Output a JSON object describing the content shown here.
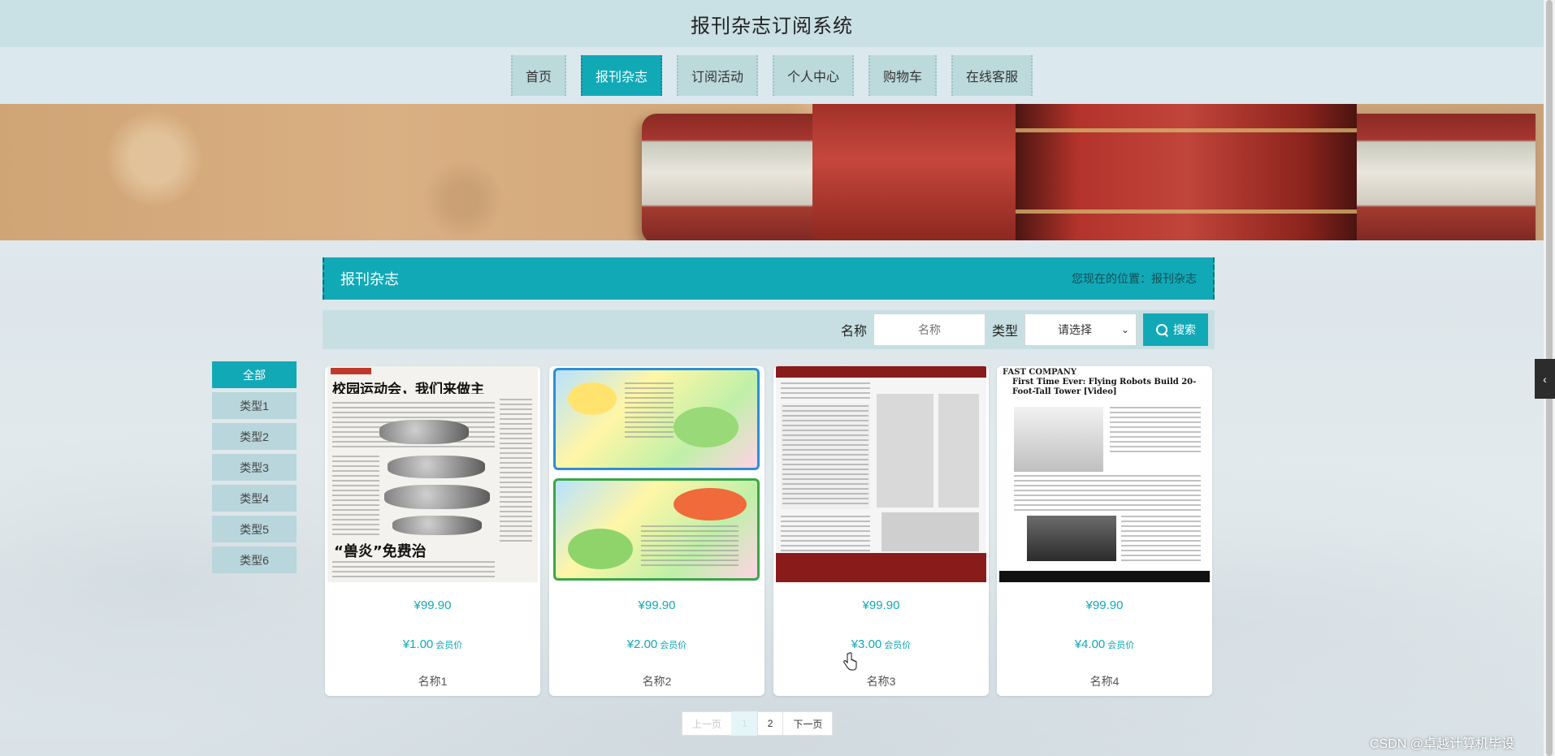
{
  "header": {
    "title": "报刊杂志订阅系统"
  },
  "nav": {
    "items": [
      {
        "label": "首页"
      },
      {
        "label": "报刊杂志"
      },
      {
        "label": "订阅活动"
      },
      {
        "label": "个人中心"
      },
      {
        "label": "购物车"
      },
      {
        "label": "在线客服"
      }
    ],
    "active": "报刊杂志"
  },
  "section": {
    "title": "报刊杂志",
    "location_prefix": "您现在的位置：",
    "location": "报刊杂志"
  },
  "search": {
    "name_label": "名称",
    "name_placeholder": "名称",
    "type_label": "类型",
    "type_selected": "请选择",
    "button_label": "搜索"
  },
  "categories": [
    {
      "label": "全部"
    },
    {
      "label": "类型1"
    },
    {
      "label": "类型2"
    },
    {
      "label": "类型3"
    },
    {
      "label": "类型4"
    },
    {
      "label": "类型5"
    },
    {
      "label": "类型6"
    }
  ],
  "products": [
    {
      "price": "¥99.90",
      "vip_price": "¥1.00",
      "vip_label": "会员价",
      "name": "名称1",
      "image_headline": "校园运动会，我们来做主",
      "image_caption": "“兽炎”免费治"
    },
    {
      "price": "¥99.90",
      "vip_price": "¥2.00",
      "vip_label": "会员价",
      "name": "名称2"
    },
    {
      "price": "¥99.90",
      "vip_price": "¥3.00",
      "vip_label": "会员价",
      "name": "名称3"
    },
    {
      "price": "¥99.90",
      "vip_price": "¥4.00",
      "vip_label": "会员价",
      "name": "名称4",
      "image_logo": "FAST COMPANY",
      "image_title": "First Time Ever: Flying Robots Build 20-Foot-Tall Tower [Video]"
    }
  ],
  "pagination": {
    "prev": "上一页",
    "pages": [
      "1",
      "2"
    ],
    "current": "1",
    "next": "下一页"
  },
  "side_tab_icon": "chevron-left-icon",
  "watermark": "CSDN @卓越计算机毕设",
  "colors": {
    "accent": "#12a9b7",
    "topbar": "#c9e0e5",
    "navbar": "#dbe8ee"
  }
}
